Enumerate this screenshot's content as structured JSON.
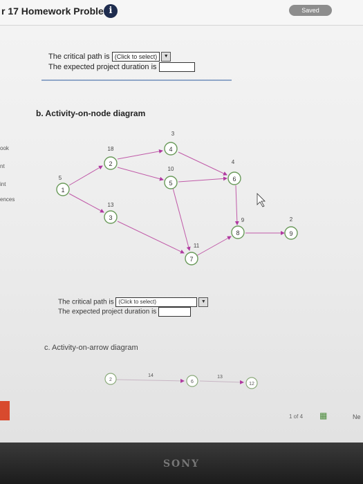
{
  "header": {
    "title": "r 17 Homework Problems",
    "info_icon": "i",
    "saved_label": "Saved"
  },
  "sidebar": [
    "ook",
    "nt",
    "int",
    "ences"
  ],
  "part_a": {
    "critical_path_label": "The critical path is",
    "select_placeholder": "(Click to select)",
    "duration_label": "The expected project duration is"
  },
  "part_b": {
    "heading": "b. Activity-on-node diagram",
    "nodes": [
      {
        "id": "1",
        "duration": "5"
      },
      {
        "id": "2",
        "duration": "18"
      },
      {
        "id": "3",
        "duration": "13"
      },
      {
        "id": "4",
        "duration": "3"
      },
      {
        "id": "5",
        "duration": "10"
      },
      {
        "id": "6",
        "duration": "4"
      },
      {
        "id": "7",
        "duration": "11"
      },
      {
        "id": "8",
        "duration": "9"
      },
      {
        "id": "9",
        "duration": "2"
      }
    ],
    "critical_path_label": "The critical path is",
    "select_placeholder": "(Click to select)",
    "duration_label": "The expected project duration is"
  },
  "part_c": {
    "heading": "c. Activity-on-arrow diagram",
    "nodes": [
      "2",
      "6",
      "12"
    ],
    "durations": [
      "14",
      "13"
    ]
  },
  "footer": {
    "pager": "1 of 4",
    "next": "Ne"
  },
  "bezel": {
    "brand": "SONY"
  }
}
